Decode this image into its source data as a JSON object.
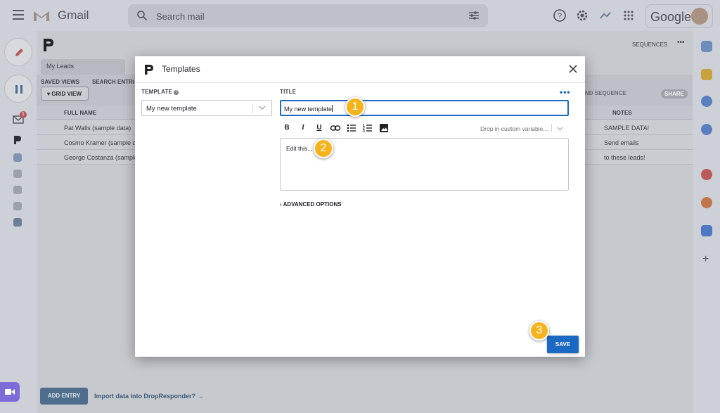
{
  "gmail": {
    "app_name": "Gmail",
    "search_placeholder": "Search mail",
    "account_label": "Google",
    "mail_badge": "1"
  },
  "background": {
    "tab_label": "My Leads",
    "saved_views_label": "SAVED VIEWS",
    "search_entries_label": "SEARCH ENTRI",
    "grid_view_label": "GRID VIEW",
    "sequences_link": "SEQUENCES",
    "send_sequence_label": "ND SEQUENCE",
    "share_label": "SHARE",
    "columns": {
      "full_name": "FULL NAME",
      "notes": "NOTES"
    },
    "rows": [
      {
        "name": "Pat Walls (sample data)",
        "note": "SAMPLE DATA!"
      },
      {
        "name": "Cosmo Kramer (sample data",
        "note": "Send emails"
      },
      {
        "name": "George Costanza (sample",
        "note": "to these leads!"
      }
    ],
    "add_entry_label": "ADD ENTRY",
    "import_link": "Import data into DropResponder? →"
  },
  "modal": {
    "title": "Templates",
    "template_label": "TEMPLATE",
    "template_info": "i",
    "template_selected": "My new template",
    "title_label": "TITLE",
    "more_label": "•••",
    "title_value": "My new template",
    "format_buttons": {
      "bold": "B",
      "italic": "I",
      "underline": "U"
    },
    "custom_variable_placeholder": "Drop in custom variable...",
    "editor_content": "Edit this...",
    "advanced_options": "› ADVANCED OPTIONS",
    "save_label": "SAVE"
  },
  "markers": [
    "1",
    "2",
    "3"
  ],
  "colors": {
    "primary_blue": "#1b69c2",
    "marker_yellow": "#f6b31b"
  }
}
